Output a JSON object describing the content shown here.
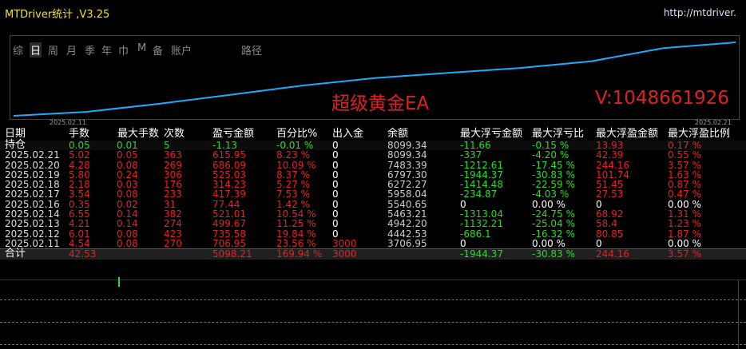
{
  "app": {
    "title": "MTDriver统计 ,V3.25",
    "url": "http://mtdriver.",
    "nav": [
      "综",
      "日",
      "周",
      "月",
      "季",
      "年",
      "巾",
      "M",
      "备",
      "账户",
      "路径"
    ],
    "nav_active": "日"
  },
  "chart": {
    "start_date": "2025.02.11",
    "end_date": "2025.02.21",
    "overlay_left": "超级黄金EA",
    "overlay_right": "V:1048661926",
    "line_color": "#1eaaff",
    "points": [
      0,
      4.3,
      13.0,
      23.0,
      33.2,
      41.4,
      46.9,
      52.3,
      59.8,
      74.1,
      80.5
    ]
  },
  "table": {
    "headers": [
      "日期",
      "手数",
      "最大手数",
      "次数",
      "盈亏金额",
      "百分比%",
      "出入金",
      "余额",
      "最大浮亏金额",
      "最大浮亏比",
      "最大浮盈金额",
      "最大浮盈比例"
    ],
    "hold": {
      "label": "持仓",
      "lots": "0.05",
      "max_lots": "0.01",
      "count": "5",
      "pnl": "-1.13",
      "pct": "-0.01 %",
      "io": "0",
      "balance": "8099.34",
      "max_float_loss": "-11.66",
      "max_float_loss_pct": "-0.15 %",
      "max_float_profit": "13.93",
      "max_float_profit_pct": "0.17 %"
    },
    "rows": [
      {
        "date": "2025.02.21",
        "lots": "5.02",
        "max_lots": "0.05",
        "count": "363",
        "pnl": "615.95",
        "pct": "8.23 %",
        "io": "0",
        "balance": "8099.34",
        "max_float_loss": "-337",
        "max_float_loss_pct": "-4.20 %",
        "max_float_profit": "42.39",
        "max_float_profit_pct": "0.55 %"
      },
      {
        "date": "2025.02.20",
        "lots": "4.28",
        "max_lots": "0.08",
        "count": "269",
        "pnl": "686.09",
        "pct": "10.09 %",
        "io": "0",
        "balance": "7483.39",
        "max_float_loss": "-1212.61",
        "max_float_loss_pct": "-17.45 %",
        "max_float_profit": "244.16",
        "max_float_profit_pct": "3.57 %"
      },
      {
        "date": "2025.02.19",
        "lots": "5.80",
        "max_lots": "0.24",
        "count": "306",
        "pnl": "525.03",
        "pct": "8.37 %",
        "io": "0",
        "balance": "6797.30",
        "max_float_loss": "-1944.37",
        "max_float_loss_pct": "-30.83 %",
        "max_float_profit": "101.74",
        "max_float_profit_pct": "1.63 %"
      },
      {
        "date": "2025.02.18",
        "lots": "2.18",
        "max_lots": "0.03",
        "count": "176",
        "pnl": "314.23",
        "pct": "5.27 %",
        "io": "0",
        "balance": "6272.27",
        "max_float_loss": "-1414.48",
        "max_float_loss_pct": "-22.59 %",
        "max_float_profit": "51.45",
        "max_float_profit_pct": "0.87 %"
      },
      {
        "date": "2025.02.17",
        "lots": "3.54",
        "max_lots": "0.08",
        "count": "233",
        "pnl": "417.39",
        "pct": "7.53 %",
        "io": "0",
        "balance": "5958.04",
        "max_float_loss": "-234.87",
        "max_float_loss_pct": "-4.03 %",
        "max_float_profit": "27.53",
        "max_float_profit_pct": "0.47 %"
      },
      {
        "date": "2025.02.16",
        "lots": "0.35",
        "max_lots": "0.02",
        "count": "31",
        "pnl": "77.44",
        "pct": "1.42 %",
        "io": "0",
        "balance": "5540.65",
        "max_float_loss": "0",
        "max_float_loss_pct": "0.00 %",
        "max_float_profit": "0",
        "max_float_profit_pct": "0.00 %"
      },
      {
        "date": "2025.02.14",
        "lots": "6.55",
        "max_lots": "0.14",
        "count": "382",
        "pnl": "521.01",
        "pct": "10.54 %",
        "io": "0",
        "balance": "5463.21",
        "max_float_loss": "-1313.04",
        "max_float_loss_pct": "-24.75 %",
        "max_float_profit": "68.92",
        "max_float_profit_pct": "1.31 %"
      },
      {
        "date": "2025.02.13",
        "lots": "4.21",
        "max_lots": "0.14",
        "count": "274",
        "pnl": "499.67",
        "pct": "11.25 %",
        "io": "0",
        "balance": "4942.20",
        "max_float_loss": "-1132.21",
        "max_float_loss_pct": "-25.04 %",
        "max_float_profit": "58.4",
        "max_float_profit_pct": "1.23 %"
      },
      {
        "date": "2025.02.12",
        "lots": "6.01",
        "max_lots": "0.08",
        "count": "423",
        "pnl": "735.58",
        "pct": "19.84 %",
        "io": "0",
        "balance": "4442.53",
        "max_float_loss": "-686.1",
        "max_float_loss_pct": "-16.32 %",
        "max_float_profit": "80.85",
        "max_float_profit_pct": "1.87 %"
      },
      {
        "date": "2025.02.11",
        "lots": "4.54",
        "max_lots": "0.08",
        "count": "270",
        "pnl": "706.95",
        "pct": "23.56 %",
        "io": "3000",
        "balance": "3706.95",
        "max_float_loss": "0",
        "max_float_loss_pct": "0.00 %",
        "max_float_profit": "0",
        "max_float_profit_pct": "0.00 %"
      }
    ],
    "total": {
      "label": "合计",
      "lots": "42.53",
      "pnl": "5098.21",
      "pct": "169.94 %",
      "io": "3000",
      "max_float_loss": "-1944.37",
      "max_float_loss_pct": "-30.83 %",
      "max_float_profit": "244.16",
      "max_float_profit_pct": "3.57 %"
    }
  }
}
